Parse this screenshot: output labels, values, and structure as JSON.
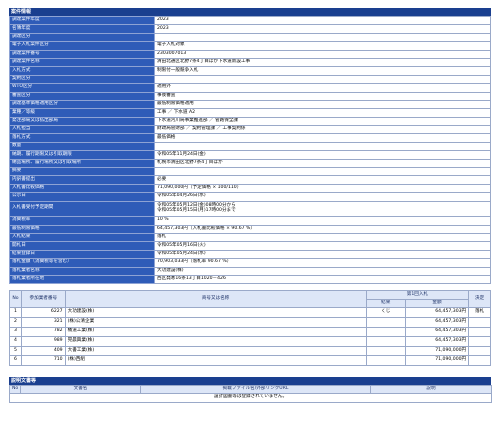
{
  "info": {
    "title": "案件情報",
    "rows": [
      {
        "label": "調達案件年度",
        "value": "2023"
      },
      {
        "label": "名簿年度",
        "value": "2023"
      },
      {
        "label": "調達区分",
        "value": ""
      },
      {
        "label": "電子入札案件区分",
        "value": "電子入札対象"
      },
      {
        "label": "調達案件番号",
        "value": "2303007013"
      },
      {
        "label": "調達案件名称",
        "value": "清田北通区北野7条4丁目ほか下水道新設工事"
      },
      {
        "label": "入札方式",
        "value": "制限付一般競争入札"
      },
      {
        "label": "契約区分",
        "value": ""
      },
      {
        "label": "WTO区分",
        "value": "適用外"
      },
      {
        "label": "審査区分",
        "value": "事後審査"
      },
      {
        "label": "調達基準価格適用区分",
        "value": "最低制限価格適用"
      },
      {
        "label": "業種／等級",
        "value": "工事 ／ 下水道 A2"
      },
      {
        "label": "発注部局又は払出部局",
        "value": "下水道河川局事業推進部 ／ 管路保全課"
      },
      {
        "label": "入札担当",
        "value": "財政局管財部 ／ 契約管理課 ／ 工事契約係"
      },
      {
        "label": "落札方式",
        "value": "最低価格"
      },
      {
        "label": "数量",
        "value": ""
      },
      {
        "label": "納期、履行期限又は引取期限",
        "value": "令和05年11月24日(金)"
      },
      {
        "label": "納品場所、履行場所又は引取場所",
        "value": "札幌市清田区北野7条4丁目ほか"
      },
      {
        "label": "摘要",
        "value": ""
      },
      {
        "label": "内訳書提出",
        "value": "必要"
      },
      {
        "label": "入札書比較価格",
        "value": "71,090,000円（予定価格 × 100/110）"
      },
      {
        "label": "公示日",
        "value": "令和05年04月26日(水)"
      },
      {
        "label": "入札書受付予定期間",
        "value": "令和05年05月12日(金)08時00分から",
        "value2": "令和05年05月15日(月)17時00分まで"
      },
      {
        "label": "消費税率",
        "value": "10 %"
      },
      {
        "label": "最低制限価格",
        "value": "64,457,303円（入札書比較価格 × 90.67 %）"
      },
      {
        "label": "入札結果",
        "value": "落札"
      },
      {
        "label": "開札日",
        "value": "令和05年05月16日(火)"
      },
      {
        "label": "結果登録日",
        "value": "令和05年05月24日(水)"
      },
      {
        "label": "落札金額（消費税等を含む）",
        "value": "70,903,033円（落札率 90.67 %）"
      },
      {
        "label": "落札業者名称",
        "value": "大功建設(株)"
      },
      {
        "label": "落札業者所在地",
        "value": "西区発寒16条13丁目1020－426"
      }
    ]
  },
  "bids": {
    "headers": {
      "no": "No",
      "member_no": "参加業者番号",
      "name": "商号又は名称",
      "round": "第1回入札",
      "result": "結果",
      "amount": "金額",
      "decision": "決定"
    },
    "rows": [
      {
        "no": "1",
        "member_no": "6227",
        "name": "大功建設(株)",
        "result": "くじ",
        "amount": "64,457,303円",
        "decision": "落札"
      },
      {
        "no": "2",
        "member_no": "321",
        "name": "(株)公清企業",
        "result": "",
        "amount": "64,457,303円",
        "decision": ""
      },
      {
        "no": "3",
        "member_no": "782",
        "name": "桶道工業(株)",
        "result": "",
        "amount": "64,457,303円",
        "decision": ""
      },
      {
        "no": "4",
        "member_no": "989",
        "name": "晃晨興業(株)",
        "result": "",
        "amount": "64,457,303円",
        "decision": ""
      },
      {
        "no": "5",
        "member_no": "409",
        "name": "大書工業(株)",
        "result": "",
        "amount": "71,090,000円",
        "decision": ""
      },
      {
        "no": "6",
        "member_no": "710",
        "name": "(株)西組",
        "result": "",
        "amount": "71,090,000円",
        "decision": ""
      }
    ]
  },
  "docs": {
    "title": "説明文書等",
    "headers": {
      "no": "No",
      "doc_name": "文書名",
      "file": "掲載ファイル名/外部リンクURL",
      "note": "説明"
    },
    "empty": "設計図書等は登録されていません。"
  }
}
